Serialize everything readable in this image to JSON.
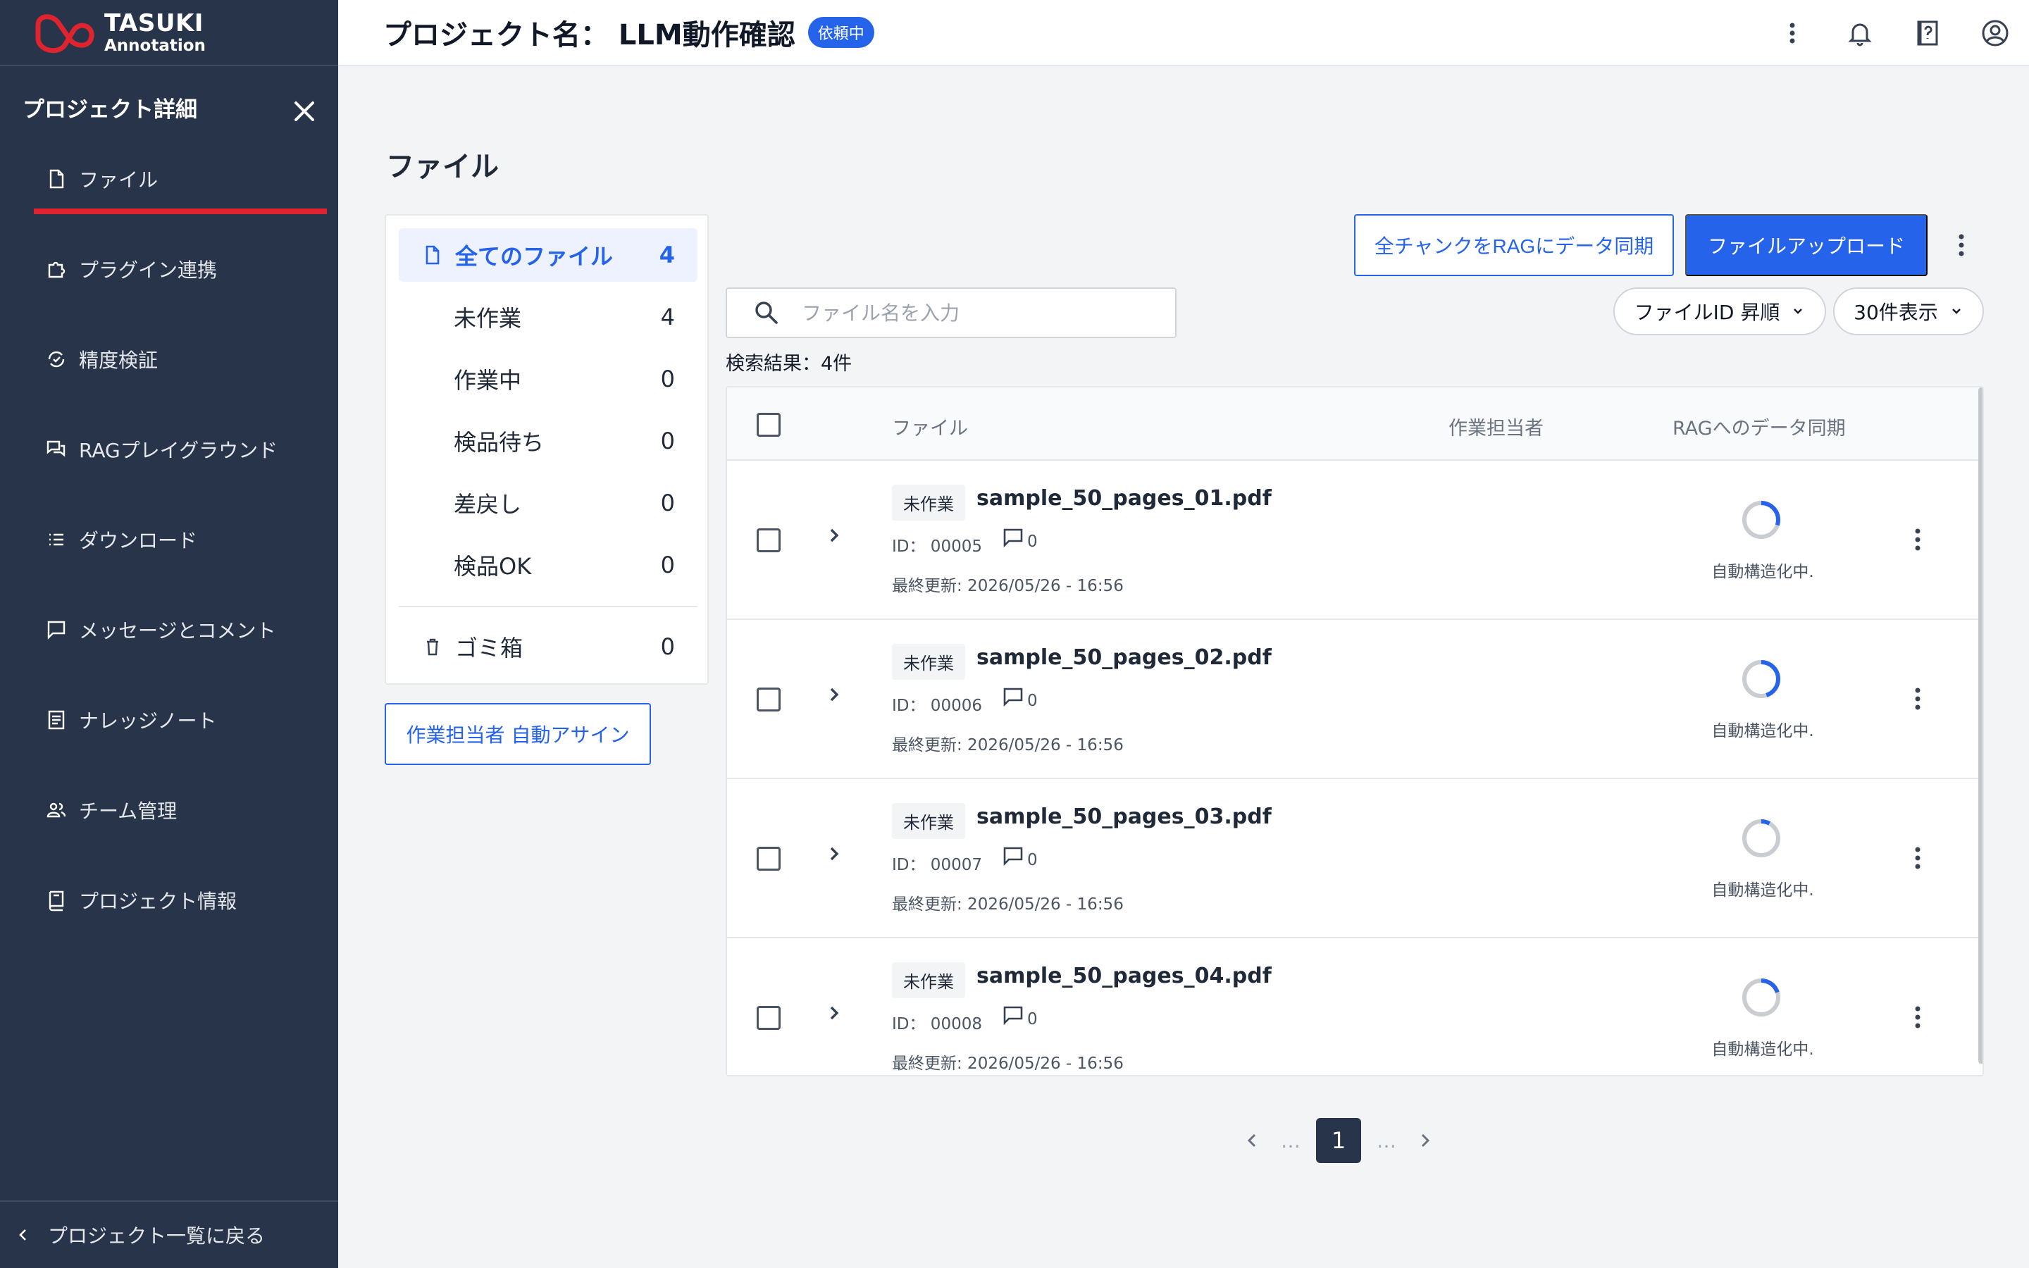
{
  "brand": {
    "line1": "TASUKI",
    "line2": "Annotation"
  },
  "header": {
    "title": "プロジェクト名： LLM動作確認",
    "status_badge": "依頼中"
  },
  "sidebar": {
    "heading": "プロジェクト詳細",
    "items": [
      {
        "label": "ファイル",
        "icon": "file-icon",
        "active": true
      },
      {
        "label": "プラグイン連携",
        "icon": "puzzle-icon"
      },
      {
        "label": "精度検証",
        "icon": "refresh-check-icon"
      },
      {
        "label": "RAGプレイグラウンド",
        "icon": "chat-bubbles-icon"
      },
      {
        "label": "ダウンロード",
        "icon": "list-icon"
      },
      {
        "label": "メッセージとコメント",
        "icon": "comment-icon"
      },
      {
        "label": "ナレッジノート",
        "icon": "note-icon"
      },
      {
        "label": "チーム管理",
        "icon": "team-icon"
      },
      {
        "label": "プロジェクト情報",
        "icon": "book-icon"
      }
    ],
    "back_label": "プロジェクト一覧に戻る"
  },
  "main": {
    "title": "ファイル",
    "filters": [
      {
        "label": "全てのファイル",
        "count": "4",
        "active": true
      },
      {
        "label": "未作業",
        "count": "4"
      },
      {
        "label": "作業中",
        "count": "0"
      },
      {
        "label": "検品待ち",
        "count": "0"
      },
      {
        "label": "差戻し",
        "count": "0"
      },
      {
        "label": "検品OK",
        "count": "0"
      }
    ],
    "trash": {
      "label": "ゴミ箱",
      "count": "0"
    },
    "assign_button": "作業担当者 自動アサイン",
    "sync_all_button": "全チャンクをRAGにデータ同期",
    "upload_button": "ファイルアップロード",
    "search_placeholder": "ファイル名を入力",
    "sort_label": "ファイルID 昇順",
    "per_page_label": "30件表示",
    "result_count": "検索結果：4件",
    "columns": {
      "file": "ファイル",
      "assignee": "作業担当者",
      "rag_sync": "RAGへのデータ同期"
    },
    "rows": [
      {
        "status": "未作業",
        "name": "sample_50_pages_01.pdf",
        "id": "ID： 00005",
        "comments": "0",
        "updated": "最終更新: 2026/05/26 - 16:56",
        "sync_status": "自動構造化中.",
        "progress": 0.3
      },
      {
        "status": "未作業",
        "name": "sample_50_pages_02.pdf",
        "id": "ID： 00006",
        "comments": "0",
        "updated": "最終更新: 2026/05/26 - 16:56",
        "sync_status": "自動構造化中.",
        "progress": 0.45
      },
      {
        "status": "未作業",
        "name": "sample_50_pages_03.pdf",
        "id": "ID： 00007",
        "comments": "0",
        "updated": "最終更新: 2026/05/26 - 16:56",
        "sync_status": "自動構造化中.",
        "progress": 0.08
      },
      {
        "status": "未作業",
        "name": "sample_50_pages_04.pdf",
        "id": "ID： 00008",
        "comments": "0",
        "updated": "最終更新: 2026/05/26 - 16:56",
        "sync_status": "自動構造化中.",
        "progress": 0.2
      }
    ],
    "pagination": {
      "current": "1",
      "ellipsis": "…"
    }
  },
  "colors": {
    "sidebar_bg": "#273449",
    "accent": "#2563eb",
    "active_underline": "#e0242f",
    "brand_red": "#e0242f"
  }
}
